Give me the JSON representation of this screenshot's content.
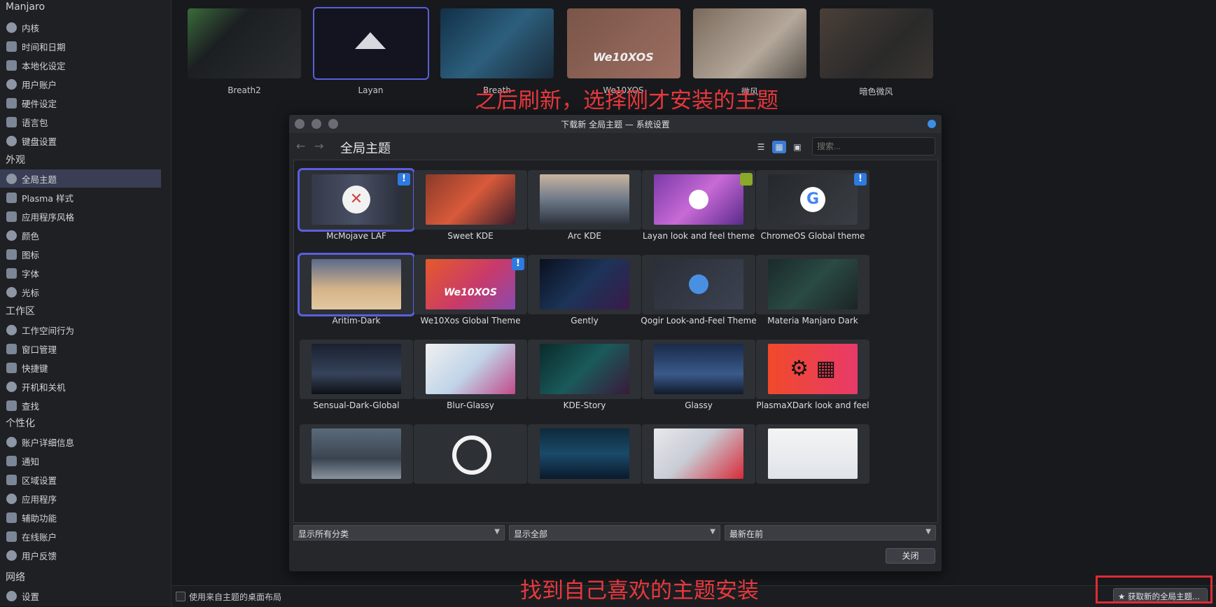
{
  "sidebar": {
    "sections": [
      {
        "title": "Manjaro",
        "items": [
          "内核",
          "时间和日期",
          "本地化设定",
          "用户账户",
          "硬件设定",
          "语言包",
          "键盘设置"
        ]
      },
      {
        "title": "外观",
        "items": [
          "全局主题",
          "Plasma 样式",
          "应用程序风格",
          "颜色",
          "图标",
          "字体",
          "光标"
        ]
      },
      {
        "title": "工作区",
        "items": [
          "工作空间行为",
          "窗口管理",
          "快捷键",
          "开机和关机",
          "查找"
        ]
      },
      {
        "title": "个性化",
        "items": [
          "账户详细信息",
          "通知",
          "区域设置",
          "应用程序",
          "辅助功能",
          "在线账户",
          "用户反馈"
        ]
      },
      {
        "title": "网络",
        "items": [
          "设置"
        ]
      }
    ],
    "active_item": "全局主题"
  },
  "installed_themes": [
    "Breath2",
    "Layan",
    "Breath",
    "We10XOS",
    "微风",
    "暗色微风"
  ],
  "annotations": {
    "top": "之后刷新，选择刚才安装的主题",
    "bottom": "找到自己喜欢的主题安装"
  },
  "dialog": {
    "title": "下载新 全局主题 — 系统设置",
    "page_title": "全局主题",
    "search_placeholder": "搜索...",
    "themes": [
      {
        "name": "McMojave LAF",
        "badge": "!"
      },
      {
        "name": "Sweet KDE",
        "badge": ""
      },
      {
        "name": "Arc KDE",
        "badge": ""
      },
      {
        "name": "Layan look and feel theme",
        "badge": "green"
      },
      {
        "name": "ChromeOS Global theme",
        "badge": "!"
      },
      {
        "name": "Aritim-Dark",
        "badge": ""
      },
      {
        "name": "We10Xos Global Theme",
        "badge": "!"
      },
      {
        "name": "Gently",
        "badge": ""
      },
      {
        "name": "Qogir Look-and-Feel Theme",
        "badge": ""
      },
      {
        "name": "Materia Manjaro Dark",
        "badge": ""
      },
      {
        "name": "Sensual-Dark-Global",
        "badge": ""
      },
      {
        "name": "Blur-Glassy",
        "badge": ""
      },
      {
        "name": "KDE-Story",
        "badge": ""
      },
      {
        "name": "Glassy",
        "badge": ""
      },
      {
        "name": "PlasmaXDark look and feel",
        "badge": ""
      },
      {
        "name": "",
        "badge": ""
      },
      {
        "name": "",
        "badge": ""
      },
      {
        "name": "",
        "badge": ""
      },
      {
        "name": "",
        "badge": ""
      },
      {
        "name": "",
        "badge": ""
      }
    ],
    "thumb_text": {
      "we10xos": "We10XOS"
    },
    "filters": {
      "category": "显示所有分类",
      "show": "显示全部",
      "sort": "最新在前"
    },
    "close_label": "关闭"
  },
  "bottom": {
    "layout_checkbox_label": "使用来自主题的桌面布局",
    "get_new_label": "★ 获取新的全局主题..."
  },
  "colors": {
    "accent": "#3a7bd5",
    "selection": "#5b5fe0",
    "annotation": "#e8383d"
  }
}
